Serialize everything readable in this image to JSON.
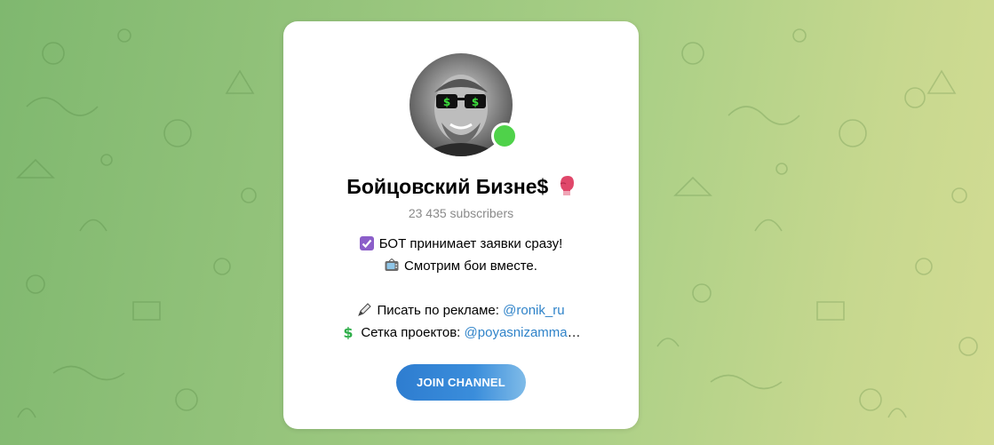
{
  "channel": {
    "title": "Бойцовский Бизне$",
    "subscribers": "23 435 subscribers",
    "online": true
  },
  "description": {
    "line1": "БОТ принимает заявки сразу!",
    "line2": "Смотрим бои вместе.",
    "line3_prefix": "Писать по рекламе: ",
    "line3_link": "@ronik_ru",
    "line4_prefix": "Сетка проектов: ",
    "line4_link": "@poyasnizamma",
    "line4_ellipsis": "…"
  },
  "join_button": {
    "label": "JOIN CHANNEL"
  },
  "colors": {
    "accent": "#2f83c9",
    "online": "#4fd24a",
    "background_start": "#7fb86f",
    "background_end": "#d3dc93"
  },
  "icons": {
    "title_emoji": "boxing-glove-icon",
    "line1_emoji": "check-box-icon",
    "line2_emoji": "tv-icon",
    "line3_emoji": "pen-icon",
    "line4_emoji": "dollar-icon"
  }
}
